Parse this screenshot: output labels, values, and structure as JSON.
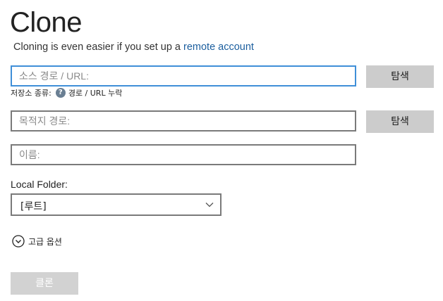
{
  "header": {
    "title": "Clone",
    "subtitle_text": "Cloning is even easier if you set up a ",
    "subtitle_link": "remote account"
  },
  "source": {
    "placeholder": "소스 경로 / URL:",
    "value": "",
    "browse_label": "탐색",
    "storage_type_label": "저장소 종류:",
    "help_icon": "?",
    "storage_type_value": "경로 / URL 누락"
  },
  "destination": {
    "placeholder": "목적지 경로:",
    "value": "",
    "browse_label": "탐색"
  },
  "name": {
    "placeholder": "이름:",
    "value": ""
  },
  "local_folder": {
    "label": "Local Folder:",
    "selected": "[루트]"
  },
  "advanced": {
    "label": "고급 옵션"
  },
  "actions": {
    "clone_label": "클론",
    "clone_enabled": false
  },
  "colors": {
    "focus_border": "#3f8fd8",
    "link": "#1b5e9e",
    "button_bg": "#cccccc",
    "disabled_button_bg": "#d2d2d2"
  }
}
